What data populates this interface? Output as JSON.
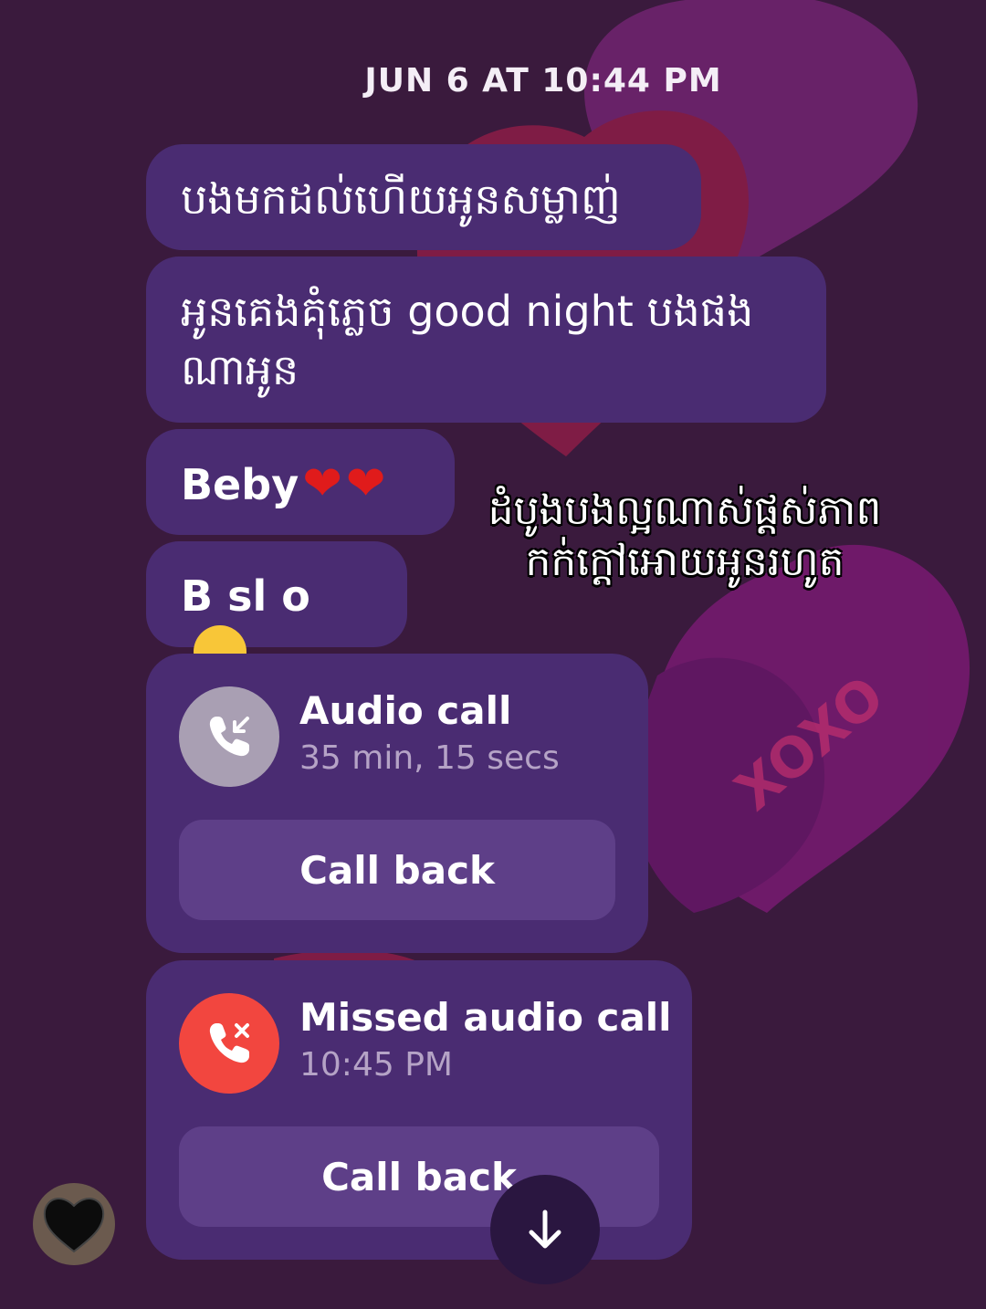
{
  "timestamp": "JUN 6 AT 10:44 PM",
  "messages": [
    {
      "text": "បងមកដល់ហើយអូនសម្លាញ់"
    },
    {
      "text": "អូនគេងគុំភ្លេច good night បងផង ណាអូន"
    },
    {
      "text": "Beby",
      "emoji": "heart-emoji"
    },
    {
      "text": "B sl o",
      "emoji": "kissing-face-emoji"
    }
  ],
  "calls": [
    {
      "title": "Audio call",
      "subtitle": "35 min, 15 secs",
      "button": "Call back",
      "icon": "incoming-call-icon",
      "icon_color": "#a99fb3"
    },
    {
      "title": "Missed audio call",
      "subtitle": "10:45 PM",
      "button": "Call back",
      "icon": "missed-call-icon",
      "icon_color": "#f2463f"
    }
  ],
  "overlay_caption": {
    "line1": "ដំបូងបងល្អណាស់ផ្តស់ភាព",
    "line2": "កក់ក្តៅអោយអូនរហូត"
  },
  "background_text": "XOXO",
  "colors": {
    "background": "#3a1a3d",
    "bubble": "#4a2c72",
    "button": "#5e3f88",
    "missed_red": "#f2463f"
  }
}
